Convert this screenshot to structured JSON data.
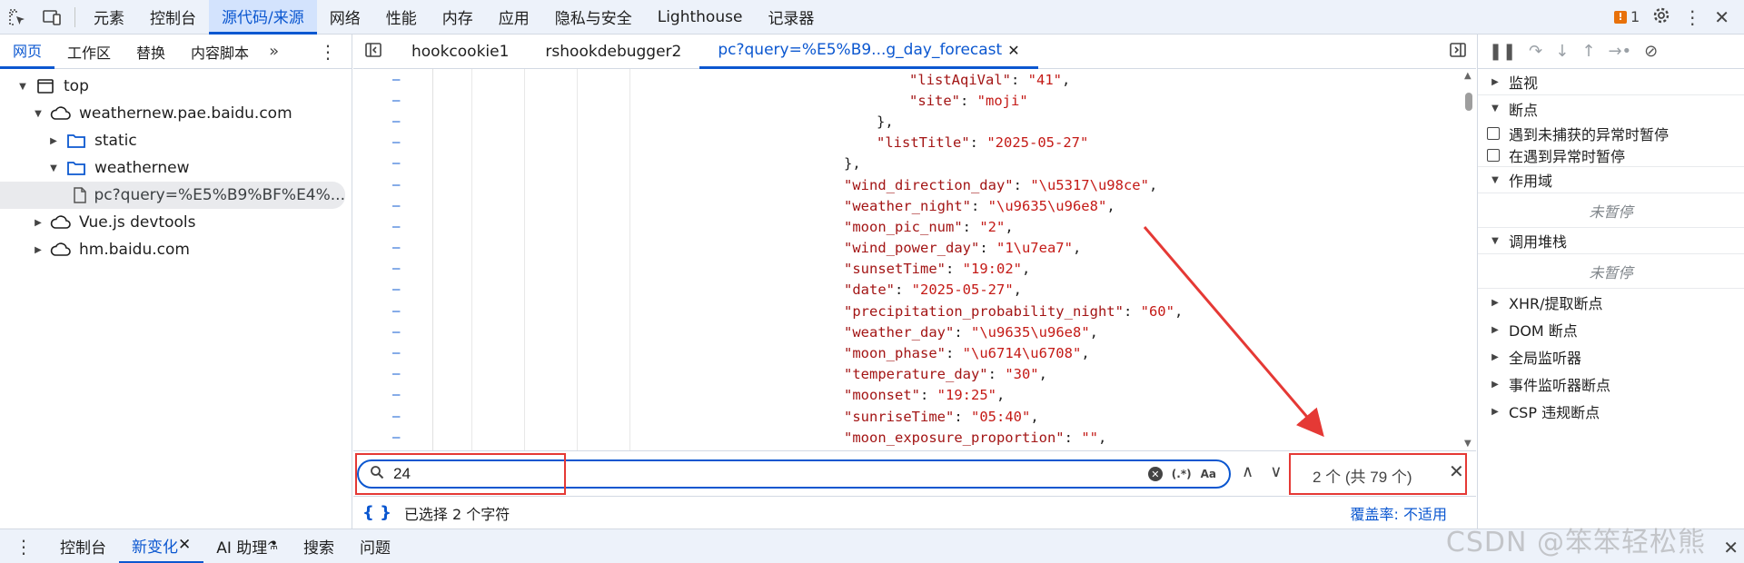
{
  "toolbar": {
    "tabs": [
      "元素",
      "控制台",
      "源代码/来源",
      "网络",
      "性能",
      "内存",
      "应用",
      "隐私与安全",
      "Lighthouse",
      "记录器"
    ],
    "active_index": 2,
    "issue_count": "1"
  },
  "navigator": {
    "tabs": [
      "网页",
      "工作区",
      "替换",
      "内容脚本"
    ],
    "tree": [
      {
        "label": "top",
        "icon": "frame-icon",
        "indent": 0,
        "arrow": "down"
      },
      {
        "label": "weathernew.pae.baidu.com",
        "icon": "cloud-icon",
        "indent": 1,
        "arrow": "down"
      },
      {
        "label": "static",
        "icon": "folder-icon",
        "indent": 2,
        "arrow": "right"
      },
      {
        "label": "weathernew",
        "icon": "folder-icon",
        "indent": 2,
        "arrow": "down"
      },
      {
        "label": "pc?query=%E5%B9%BF%E4%...",
        "icon": "file-icon",
        "indent": 3,
        "arrow": "none"
      },
      {
        "label": "Vue.js devtools",
        "icon": "cloud-icon",
        "indent": 1,
        "arrow": "right"
      },
      {
        "label": "hm.baidu.com",
        "icon": "cloud-icon",
        "indent": 1,
        "arrow": "right"
      }
    ]
  },
  "editor": {
    "tabs": [
      "hookcookie1",
      "rshookdebugger2",
      "pc?query=%E5%B9...g_day_forecast"
    ],
    "active_index": 2,
    "lines": [
      {
        "indent": 3,
        "key": "\"listAqiVal\"",
        "value": "\"41\"",
        "tail": ","
      },
      {
        "indent": 3,
        "key": "\"site\"",
        "value": "\"moji\"",
        "tail": ""
      },
      {
        "indent": 2,
        "key": "",
        "value": "",
        "tail": "},"
      },
      {
        "indent": 2,
        "key": "\"listTitle\"",
        "value": "\"2025-05-27\"",
        "tail": ""
      },
      {
        "indent": 1,
        "key": "",
        "value": "",
        "tail": "},"
      },
      {
        "indent": 1,
        "key": "\"wind_direction_day\"",
        "value": "\"\\u5317\\u98ce\"",
        "tail": ","
      },
      {
        "indent": 1,
        "key": "\"weather_night\"",
        "value": "\"\\u9635\\u96e8\"",
        "tail": ","
      },
      {
        "indent": 1,
        "key": "\"moon_pic_num\"",
        "value": "\"2\"",
        "tail": ","
      },
      {
        "indent": 1,
        "key": "\"wind_power_day\"",
        "value": "\"1\\u7ea7\"",
        "tail": ","
      },
      {
        "indent": 1,
        "key": "\"sunsetTime\"",
        "value": "\"19:02\"",
        "tail": ","
      },
      {
        "indent": 1,
        "key": "\"date\"",
        "value": "\"2025-05-27\"",
        "tail": ","
      },
      {
        "indent": 1,
        "key": "\"precipitation_probability_night\"",
        "value": "\"60\"",
        "tail": ","
      },
      {
        "indent": 1,
        "key": "\"weather_day\"",
        "value": "\"\\u9635\\u96e8\"",
        "tail": ","
      },
      {
        "indent": 1,
        "key": "\"moon_phase\"",
        "value": "\"\\u6714\\u6708\"",
        "tail": ","
      },
      {
        "indent": 1,
        "key": "\"temperature_day\"",
        "value": "\"30\"",
        "tail": ","
      },
      {
        "indent": 1,
        "key": "\"moonset\"",
        "value": "\"19:25\"",
        "tail": ","
      },
      {
        "indent": 1,
        "key": "\"sunriseTime\"",
        "value": "\"05:40\"",
        "tail": ","
      },
      {
        "indent": 1,
        "key": "\"moon_exposure_proportion\"",
        "value": "\"\"",
        "tail": ","
      }
    ]
  },
  "search": {
    "query": "24",
    "regex_label": "(.*)",
    "case_label": "Aa",
    "match_count": "2 个 (共 79 个)"
  },
  "status": {
    "selection": "已选择 2 个字符",
    "coverage": "覆盖率: 不适用"
  },
  "debugger": {
    "watch": "监视",
    "breakpoints": "断点",
    "pause_uncaught": "遇到未捕获的异常时暂停",
    "pause_caught": "在遇到异常时暂停",
    "scope": "作用域",
    "scope_status": "未暂停",
    "callstack": "调用堆栈",
    "callstack_status": "未暂停",
    "more_sections": [
      "XHR/提取断点",
      "DOM 断点",
      "全局监听器",
      "事件监听器断点",
      "CSP 违规断点"
    ]
  },
  "drawer": {
    "tabs": [
      "控制台",
      "新变化",
      "AI 助理",
      "搜索",
      "问题"
    ],
    "active_index": 1
  },
  "watermark": "CSDN @笨笨轻松熊",
  "colors": {
    "accent": "#0b57d0",
    "highlight_box": "#e53935",
    "code_string": "#c41a16"
  }
}
